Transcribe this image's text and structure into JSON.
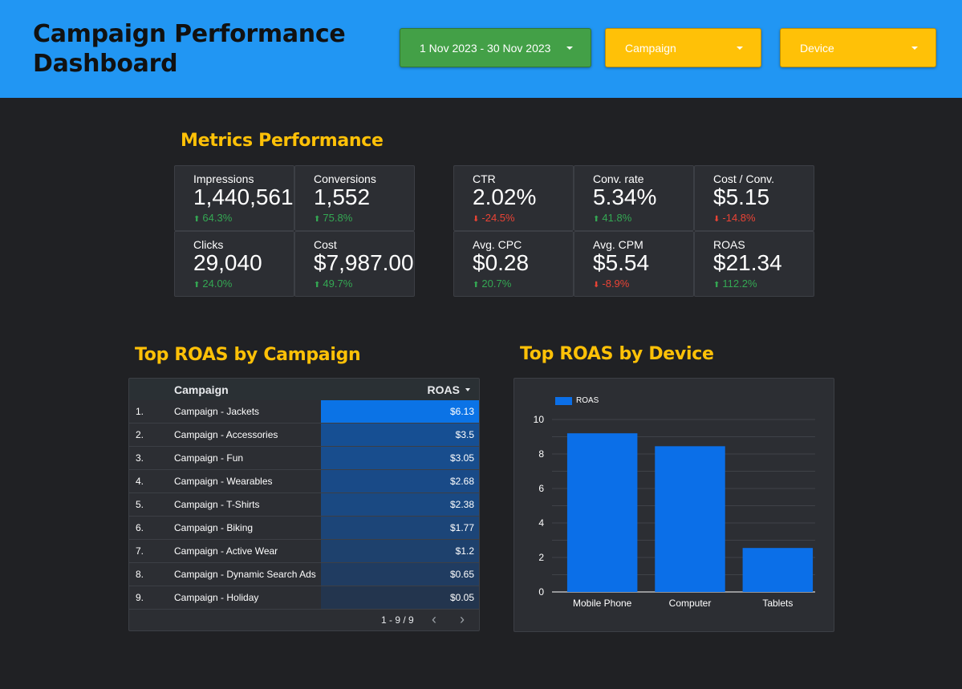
{
  "header": {
    "title_line1": "Campaign Performance",
    "title_line2": "Dashboard",
    "date_range": "1 Nov 2023 - 30 Nov 2023",
    "campaign_filter": "Campaign",
    "device_filter": "Device",
    "colors": {
      "bar": "#2196f3",
      "date_button": "#43a047",
      "filter_button": "#ffc107"
    }
  },
  "metrics": {
    "title": "Metrics Performance",
    "cards": [
      {
        "name": "Impressions",
        "value": "1,440,561",
        "delta": "64.3%",
        "trend": "up"
      },
      {
        "name": "Conversions",
        "value": "1,552",
        "delta": "75.8%",
        "trend": "up"
      },
      {
        "name": "Clicks",
        "value": "29,040",
        "delta": "24.0%",
        "trend": "up"
      },
      {
        "name": "Cost",
        "value": "$7,987.00",
        "delta": "49.7%",
        "trend": "up"
      },
      {
        "name": "CTR",
        "value": "2.02%",
        "delta": "-24.5%",
        "trend": "down"
      },
      {
        "name": "Conv. rate",
        "value": "5.34%",
        "delta": "41.8%",
        "trend": "up"
      },
      {
        "name": "Cost / Conv.",
        "value": "$5.15",
        "delta": "-14.8%",
        "trend": "down"
      },
      {
        "name": "Avg. CPC",
        "value": "$0.28",
        "delta": "20.7%",
        "trend": "up"
      },
      {
        "name": "Avg. CPM",
        "value": "$5.54",
        "delta": "-8.9%",
        "trend": "down"
      },
      {
        "name": "ROAS",
        "value": "$21.34",
        "delta": "112.2%",
        "trend": "up"
      }
    ]
  },
  "campaign_table": {
    "title": "Top ROAS by Campaign",
    "columns": [
      "Campaign",
      "ROAS"
    ],
    "rows": [
      {
        "num": "1.",
        "campaign": "Campaign - Jackets",
        "roas": "$6.13",
        "roas_value": 6.13
      },
      {
        "num": "2.",
        "campaign": "Campaign - Accessories",
        "roas": "$3.5",
        "roas_value": 3.5
      },
      {
        "num": "3.",
        "campaign": "Campaign - Fun",
        "roas": "$3.05",
        "roas_value": 3.05
      },
      {
        "num": "4.",
        "campaign": "Campaign - Wearables",
        "roas": "$2.68",
        "roas_value": 2.68
      },
      {
        "num": "5.",
        "campaign": "Campaign - T-Shirts",
        "roas": "$2.38",
        "roas_value": 2.38
      },
      {
        "num": "6.",
        "campaign": "Campaign - Biking",
        "roas": "$1.77",
        "roas_value": 1.77
      },
      {
        "num": "7.",
        "campaign": "Campaign - Active Wear",
        "roas": "$1.2",
        "roas_value": 1.2
      },
      {
        "num": "8.",
        "campaign": "Campaign - Dynamic Search Ads",
        "roas": "$0.65",
        "roas_value": 0.65
      },
      {
        "num": "9.",
        "campaign": "Campaign - Holiday",
        "roas": "$0.05",
        "roas_value": 0.05
      }
    ],
    "pagination": "1 - 9 / 9",
    "prev_icon": "chevron-left-icon",
    "next_icon": "chevron-right-icon"
  },
  "device_chart": {
    "title": "Top ROAS by Device"
  },
  "chart_data": {
    "type": "bar",
    "categories": [
      "Mobile Phone",
      "Computer",
      "Tablets"
    ],
    "series": [
      {
        "name": "ROAS",
        "values": [
          9.2,
          8.45,
          2.55
        ],
        "color": "#0b6fe8"
      }
    ],
    "xlabel": "",
    "ylabel": "",
    "ylim": [
      0,
      10
    ],
    "yticks": [
      "0",
      "2",
      "4",
      "6",
      "8",
      "10"
    ],
    "grid": true,
    "legend": "top-left"
  }
}
